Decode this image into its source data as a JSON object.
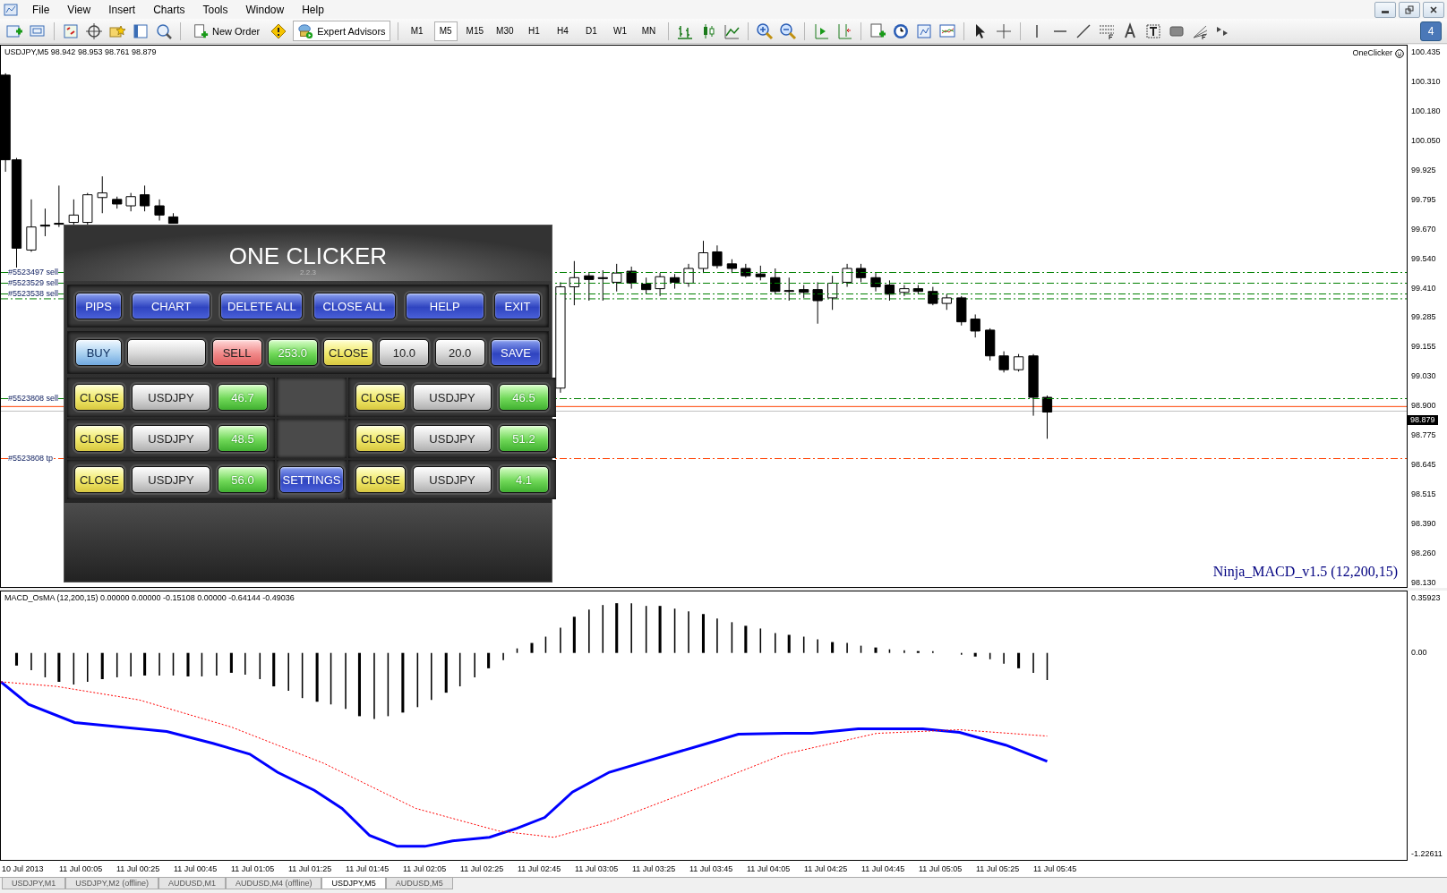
{
  "menu": [
    "File",
    "View",
    "Insert",
    "Charts",
    "Tools",
    "Window",
    "Help"
  ],
  "toolbar": {
    "new_order": "New Order",
    "expert_advisors": "Expert Advisors",
    "timeframes": [
      {
        "label": "M1",
        "selected": false
      },
      {
        "label": "M5",
        "selected": true
      },
      {
        "label": "M15",
        "selected": false
      },
      {
        "label": "M30",
        "selected": false
      },
      {
        "label": "H1",
        "selected": false
      },
      {
        "label": "H4",
        "selected": false
      },
      {
        "label": "D1",
        "selected": false
      },
      {
        "label": "W1",
        "selected": false
      },
      {
        "label": "MN",
        "selected": false
      }
    ],
    "message_count": "4"
  },
  "chart": {
    "header": "USDJPY,M5  98.942 98.953 98.761 98.879",
    "expert_name": "OneClicker",
    "indicator_label": "Ninja_MACD_v1.5 (12,200,15)",
    "price_labels": [
      "100.435",
      "100.310",
      "100.180",
      "100.050",
      "99.925",
      "99.795",
      "99.670",
      "99.540",
      "99.410",
      "99.285",
      "99.155",
      "99.030",
      "98.900",
      "98.775",
      "98.645",
      "98.515",
      "98.390",
      "98.260",
      "98.130"
    ],
    "current_price": "98.879",
    "orders": [
      {
        "label": "#5523497 sell",
        "color": "#008000"
      },
      {
        "label": "#5523529 sell",
        "color": "#008000"
      },
      {
        "label": "#5523538 sell",
        "color": "#008000"
      },
      {
        "label": "#5523808 sell",
        "color": "#008000"
      },
      {
        "label": "#5523808 tp",
        "color": "#ff4000"
      }
    ]
  },
  "panel": {
    "title": "ONE CLICKER",
    "version": "2.2.3",
    "top_buttons": [
      {
        "label": "PIPS",
        "kind": "blue"
      },
      {
        "label": "CHART",
        "kind": "blue"
      },
      {
        "label": "DELETE ALL",
        "kind": "blue"
      },
      {
        "label": "CLOSE ALL",
        "kind": "blue"
      },
      {
        "label": "HELP",
        "kind": "blue"
      },
      {
        "label": "EXIT",
        "kind": "blue"
      }
    ],
    "trade_buttons": [
      {
        "label": "BUY",
        "kind": "sky"
      },
      {
        "kind": "silver"
      },
      {
        "label": "SELL",
        "kind": "red"
      },
      {
        "label": "253.0",
        "kind": "green"
      },
      {
        "label": "CLOSE",
        "kind": "yellow"
      },
      {
        "label": "10.0",
        "kind": "silver"
      },
      {
        "label": "20.0",
        "kind": "silver"
      },
      {
        "label": "SAVE",
        "kind": "blue"
      }
    ],
    "position_rows": [
      {
        "left": {
          "close": "CLOSE",
          "symbol": "USDJPY",
          "pips": "46.7"
        },
        "right": {
          "close": "CLOSE",
          "symbol": "USDJPY",
          "pips": "46.5"
        }
      },
      {
        "left": {
          "close": "CLOSE",
          "symbol": "USDJPY",
          "pips": "48.5"
        },
        "right": {
          "close": "CLOSE",
          "symbol": "USDJPY",
          "pips": "51.2"
        }
      },
      {
        "left": {
          "close": "CLOSE",
          "symbol": "USDJPY",
          "pips": "56.0"
        },
        "right": {
          "close": "CLOSE",
          "symbol": "USDJPY",
          "pips": "4.1"
        }
      }
    ],
    "settings_button": "SETTINGS"
  },
  "indicator": {
    "header": "MACD_OsMA (12,200,15) 0.00000 0.00000 -0.15108 0.00000 -0.64144 -0.49036",
    "labels": [
      "0.35923",
      "0.00",
      "-1.22611"
    ]
  },
  "time_labels": [
    "10 Jul 2013",
    "11 Jul 00:05",
    "11 Jul 00:25",
    "11 Jul 00:45",
    "11 Jul 01:05",
    "11 Jul 01:25",
    "11 Jul 01:45",
    "11 Jul 02:05",
    "11 Jul 02:25",
    "11 Jul 02:45",
    "11 Jul 03:05",
    "11 Jul 03:25",
    "11 Jul 03:45",
    "11 Jul 04:05",
    "11 Jul 04:25",
    "11 Jul 04:45",
    "11 Jul 05:05",
    "11 Jul 05:25",
    "11 Jul 05:45"
  ],
  "tabs": [
    {
      "label": "USDJPY,M1",
      "selected": false
    },
    {
      "label": "USDJPY,M2 (offline)",
      "selected": false
    },
    {
      "label": "AUDUSD,M1",
      "selected": false
    },
    {
      "label": "AUDUSD,M4 (offline)",
      "selected": false
    },
    {
      "label": "USDJPY,M5",
      "selected": true
    },
    {
      "label": "AUDUSD,M5",
      "selected": false
    }
  ]
}
